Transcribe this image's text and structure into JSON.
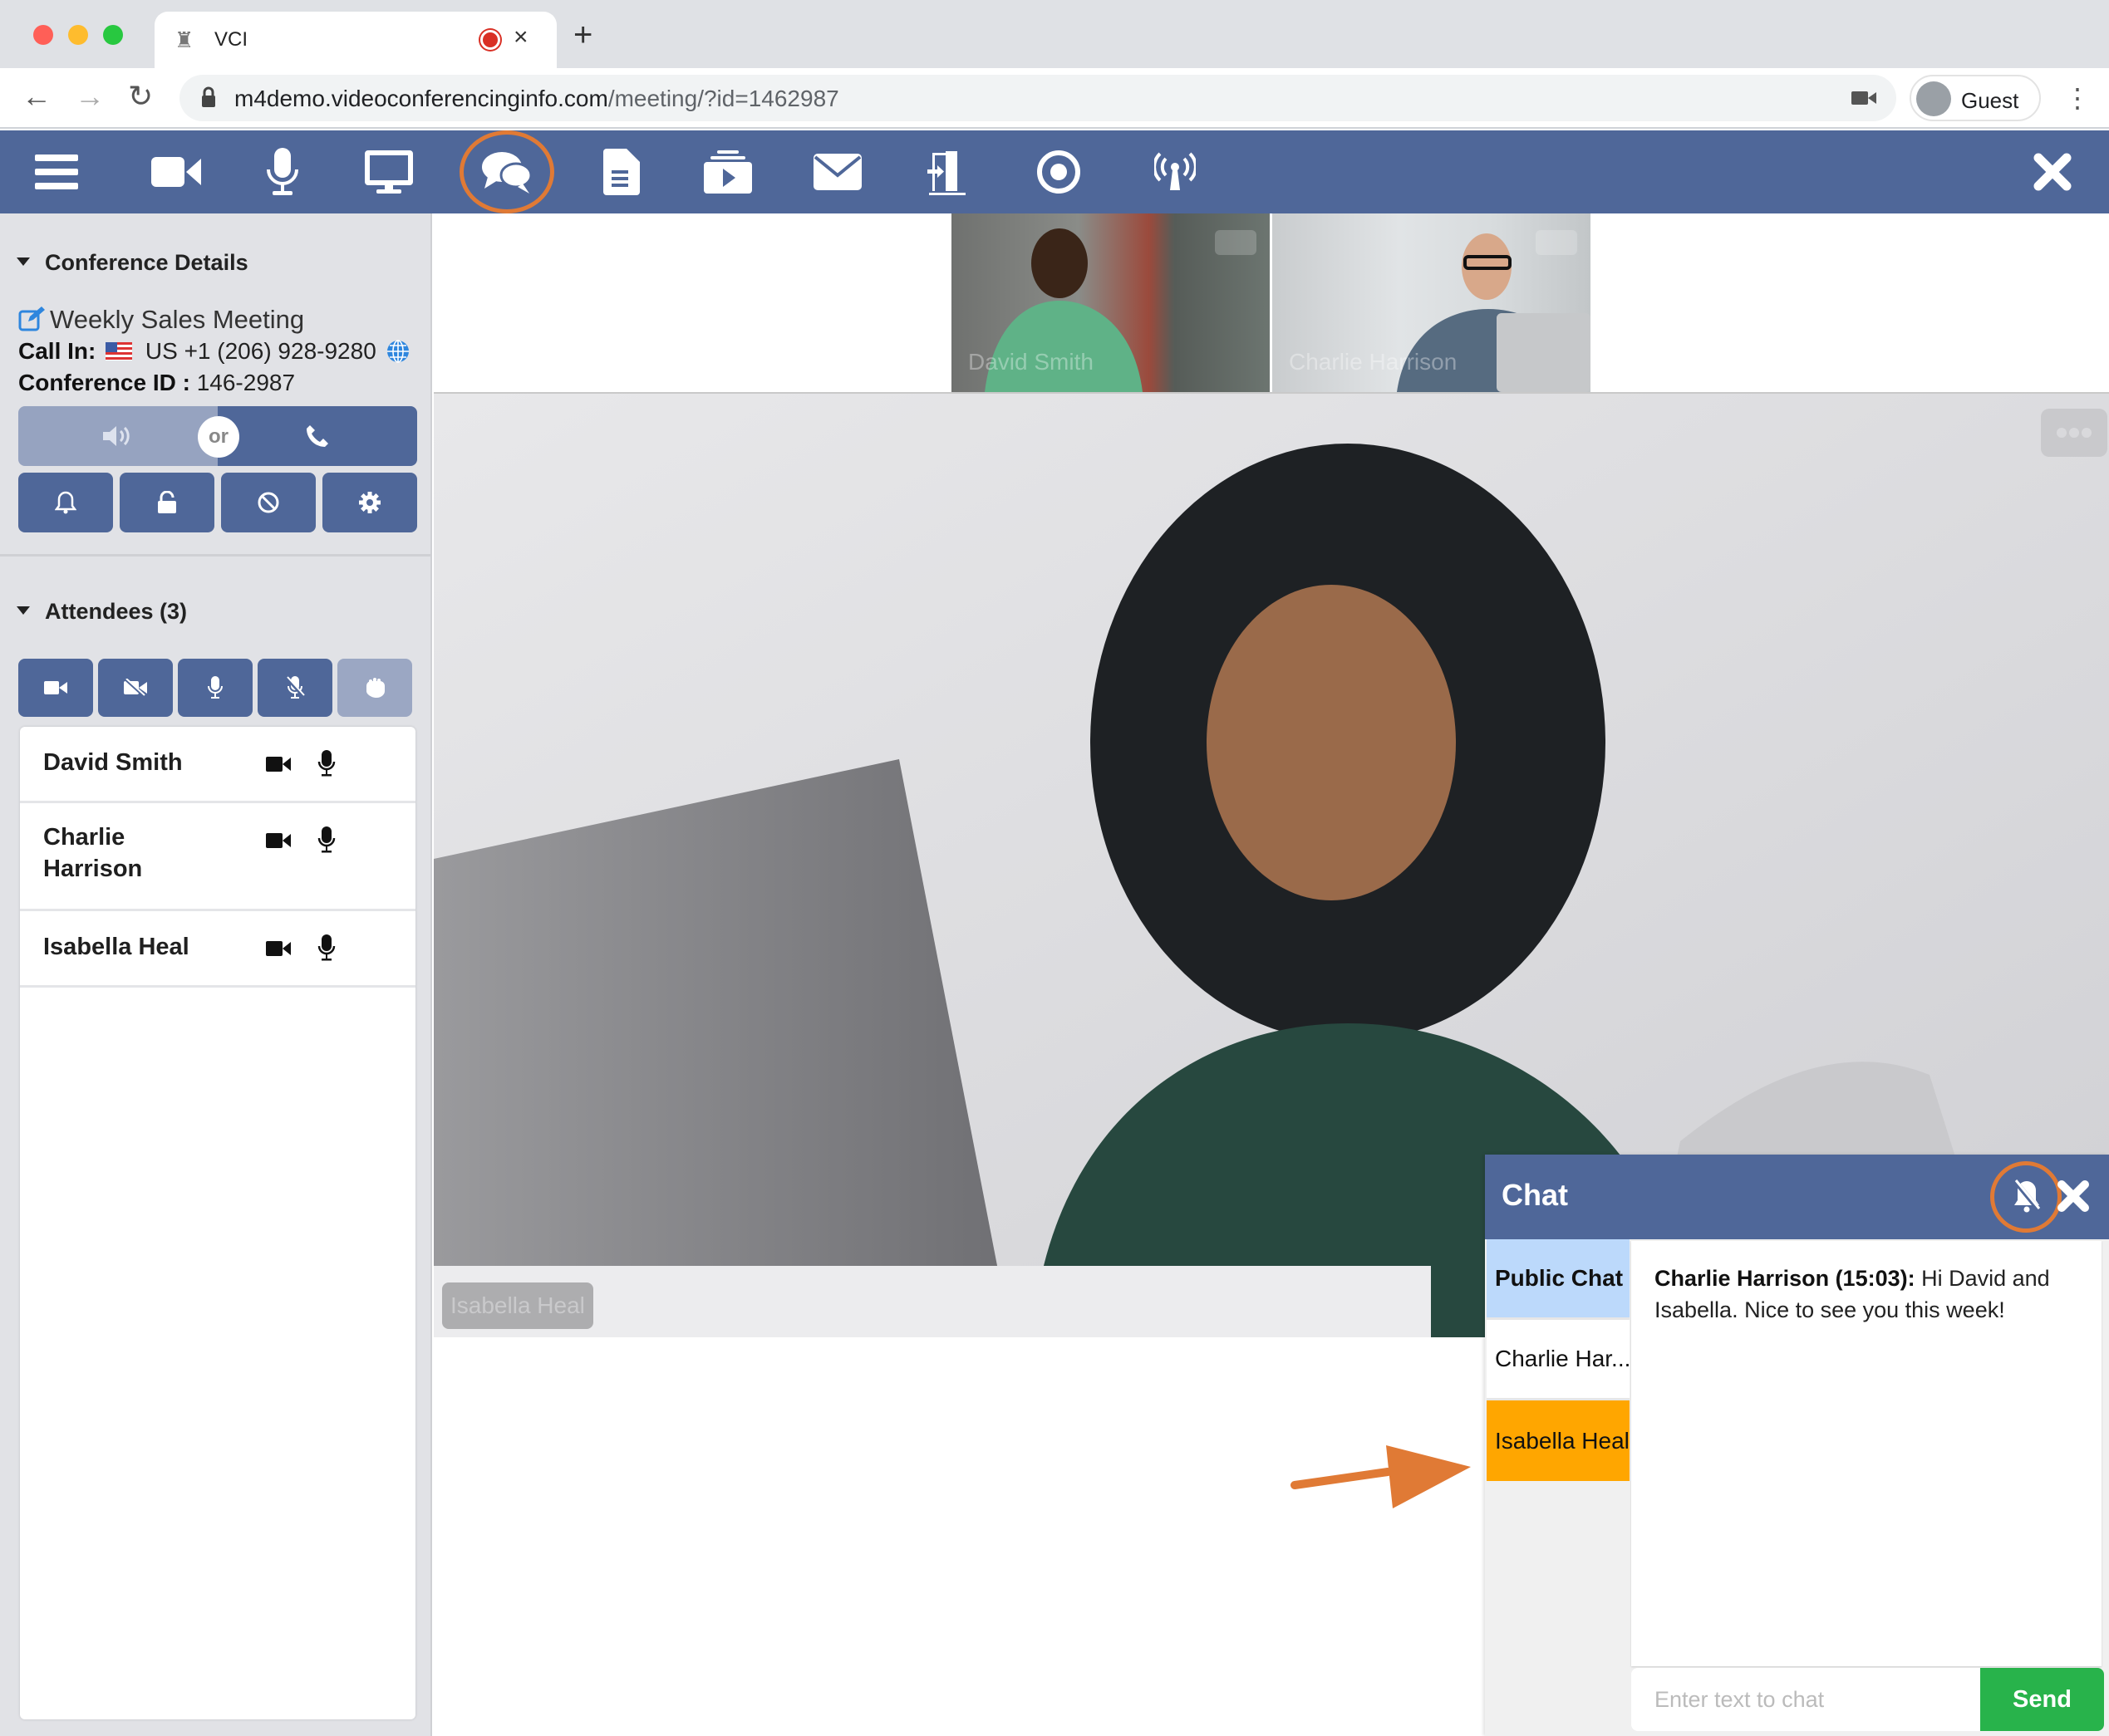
{
  "browser": {
    "tab_title": "VCI",
    "url_host": "m4demo.videoconferencinginfo.com",
    "url_path": "/meeting/?id=1462987",
    "profile_label": "Guest",
    "new_tab_symbol": "+",
    "tab_close_symbol": "×"
  },
  "toolbar": {
    "items": [
      {
        "name": "menu",
        "icon": "hamburger-icon"
      },
      {
        "name": "video",
        "icon": "video-camera-icon"
      },
      {
        "name": "microphone",
        "icon": "microphone-icon"
      },
      {
        "name": "screen-share",
        "icon": "desktop-icon"
      },
      {
        "name": "chat",
        "icon": "chat-bubbles-icon",
        "highlighted": true
      },
      {
        "name": "documents",
        "icon": "document-icon"
      },
      {
        "name": "media",
        "icon": "media-play-icon"
      },
      {
        "name": "invite-email",
        "icon": "envelope-icon"
      },
      {
        "name": "leave",
        "icon": "door-exit-icon"
      },
      {
        "name": "record",
        "icon": "record-icon"
      },
      {
        "name": "broadcast",
        "icon": "broadcast-icon"
      },
      {
        "name": "close",
        "icon": "close-icon"
      }
    ],
    "brand_color": "#4f6799",
    "highlight_color": "#e07a35"
  },
  "sidebar": {
    "conference_details": {
      "heading": "Conference Details",
      "meeting_title": "Weekly Sales Meeting",
      "call_in_label": "Call In:",
      "call_in_number": "US +1 (206) 928-9280",
      "conference_id_label": "Conference ID :",
      "conference_id": "146-2987",
      "audio_toggle": {
        "left_icon": "speaker-icon",
        "or_label": "or",
        "right_icon": "phone-icon"
      },
      "controls": [
        "bell-icon",
        "unlock-icon",
        "ban-icon",
        "gear-icon"
      ]
    },
    "attendees": {
      "heading": "Attendees (3)",
      "bulk_controls": [
        "video-on-icon",
        "video-off-icon",
        "mic-on-icon",
        "mic-off-icon",
        "raise-hand-icon"
      ],
      "list": [
        {
          "name": "David Smith",
          "video": true,
          "mic": true
        },
        {
          "name": "Charlie Harrison",
          "video": true,
          "mic": true
        },
        {
          "name": "Isabella Heal",
          "video": true,
          "mic": true
        }
      ]
    }
  },
  "video": {
    "thumbnails": [
      {
        "name": "David Smith"
      },
      {
        "name": "Charlie Harrison"
      }
    ],
    "main_speaker": "Isabella Heal"
  },
  "chat": {
    "title": "Chat",
    "tabs": [
      {
        "label": "Public Chat",
        "state": "active",
        "color": "#bcd9fb"
      },
      {
        "label": "Charlie Har...",
        "state": "normal",
        "color": "#ffffff"
      },
      {
        "label": "Isabella Heal",
        "state": "unread",
        "color": "#ffa600"
      }
    ],
    "messages": [
      {
        "sender": "Charlie Harrison (15:03):",
        "text": " Hi David and Isabella. Nice to see you this week!"
      }
    ],
    "input_placeholder": "Enter text to chat",
    "input_value": "",
    "send_label": "Send",
    "send_color": "#28b34b"
  }
}
